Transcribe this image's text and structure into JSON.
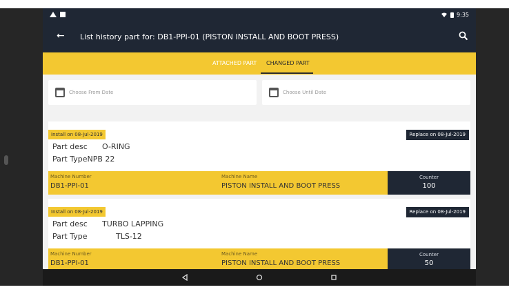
{
  "status": {
    "time": "9:35"
  },
  "appbar": {
    "title": "List history part for: DB1-PPI-01 (PISTON INSTALL AND BOOT PRESS)"
  },
  "tabs": [
    {
      "label": "ATTACHED PART"
    },
    {
      "label": "CHANGED PART"
    }
  ],
  "dates": {
    "from_placeholder": "Choose From Date",
    "until_placeholder": "Choose Until Date"
  },
  "records": [
    {
      "install": "Install on 08-Jul-2019",
      "replace": "Replace on 08-Jul-2019",
      "desc_label": "Part desc",
      "desc": "O-RING",
      "type_label": "Part Type",
      "type": "NPB 22",
      "machine_number_label": "Machine Number",
      "machine_number": "DB1-PPI-01",
      "machine_name_label": "Machine Name",
      "machine_name": "PISTON INSTALL AND BOOT PRESS",
      "counter_label": "Counter",
      "counter": "100"
    },
    {
      "install": "Install on 08-Jul-2019",
      "replace": "Replace on 08-Jul-2019",
      "desc_label": "Part desc",
      "desc": "TURBO LAPPING",
      "type_label": "Part Type",
      "type": "TLS-12",
      "machine_number_label": "Machine Number",
      "machine_number": "DB1-PPI-01",
      "machine_name_label": "Machine Name",
      "machine_name": "PISTON INSTALL AND BOOT PRESS",
      "counter_label": "Counter",
      "counter": "50"
    }
  ],
  "colors": {
    "primary": "#1f2734",
    "accent": "#f3c831"
  },
  "icons": {
    "back": "arrow-left",
    "search": "search",
    "calendar": "calendar",
    "nav_back": "triangle-left",
    "nav_home": "circle",
    "nav_recent": "square"
  }
}
